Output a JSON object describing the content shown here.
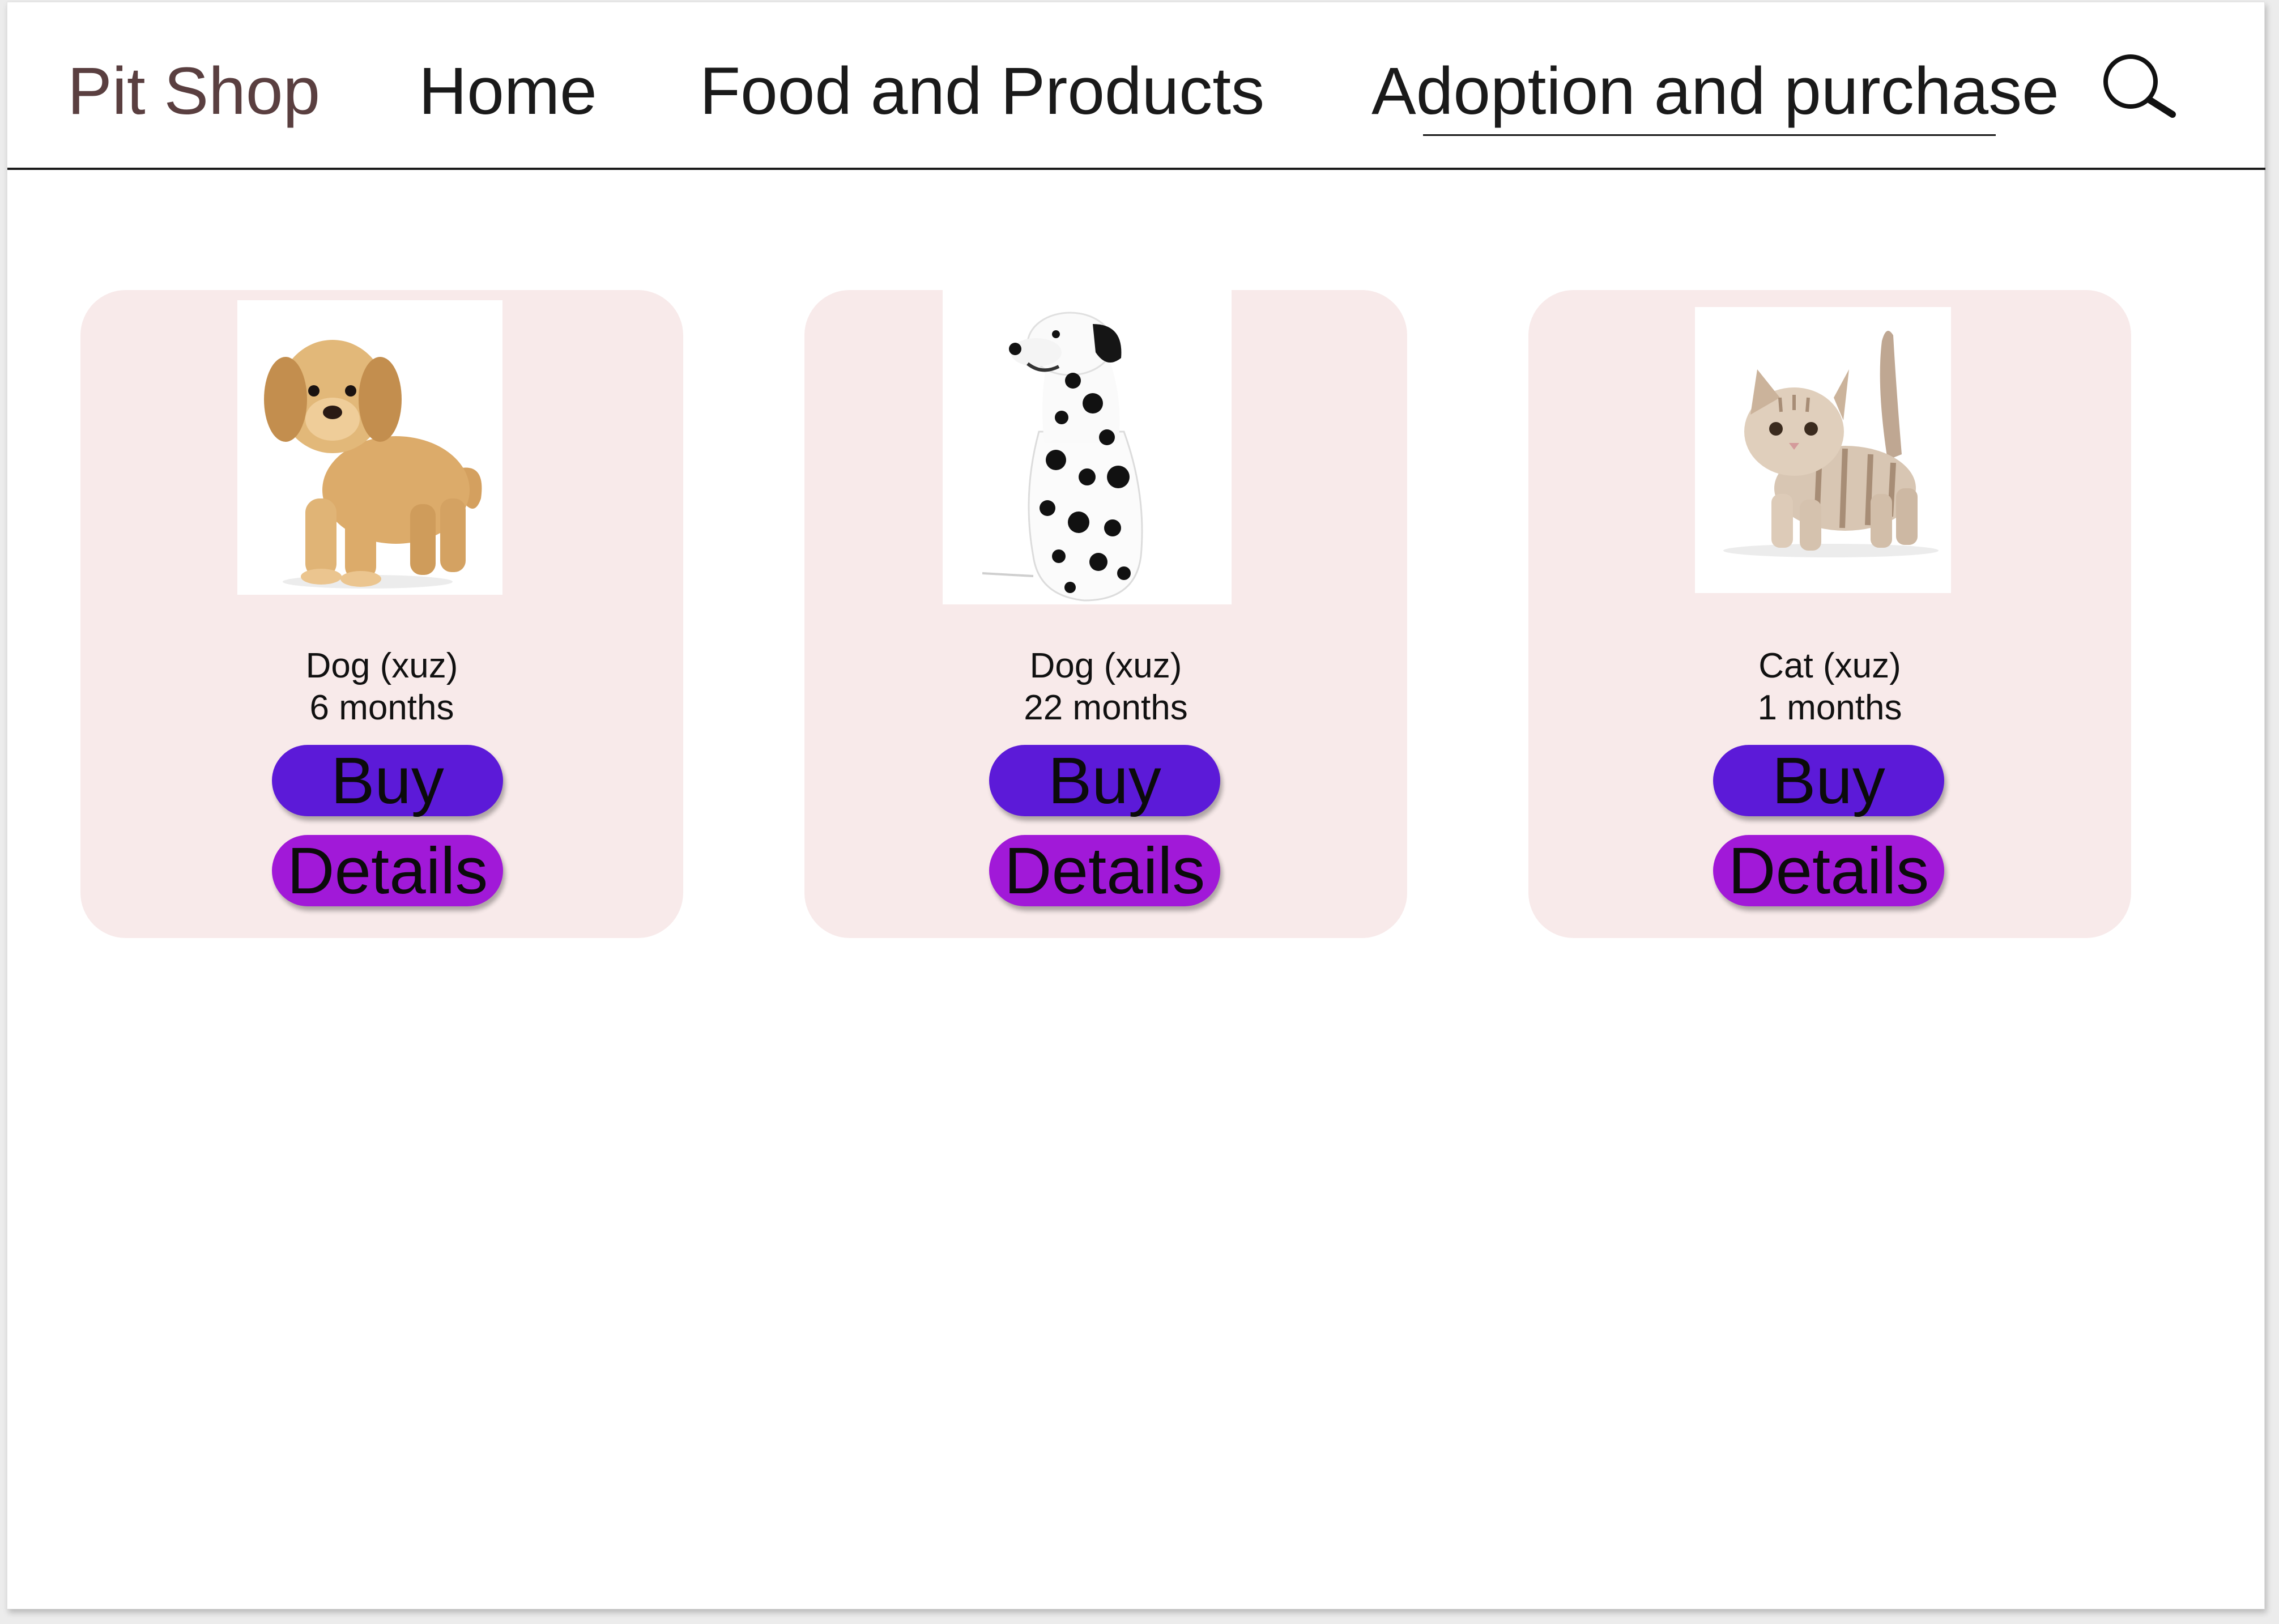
{
  "header": {
    "brand": "Pit Shop",
    "nav": [
      {
        "label": "Home",
        "active": false
      },
      {
        "label": "Food and Products",
        "active": false
      },
      {
        "label": "Adoption and purchase",
        "active": true
      }
    ],
    "search_icon": "search-icon"
  },
  "pets": [
    {
      "name": "Dog (xuz)",
      "age": "6 months",
      "buy_label": "Buy",
      "details_label": "Details",
      "image_icon": "golden-puppy-image"
    },
    {
      "name": "Dog (xuz)",
      "age": "22 months",
      "buy_label": "Buy",
      "details_label": "Details",
      "image_icon": "dalmatian-image"
    },
    {
      "name": "Cat (xuz)",
      "age": "1 months",
      "buy_label": "Buy",
      "details_label": "Details",
      "image_icon": "tabby-kitten-image"
    }
  ],
  "colors": {
    "card_background": "#f8eaea",
    "buy_button": "#5c1ad8",
    "details_button": "#a119d8",
    "brand_text": "#5a3f40"
  }
}
